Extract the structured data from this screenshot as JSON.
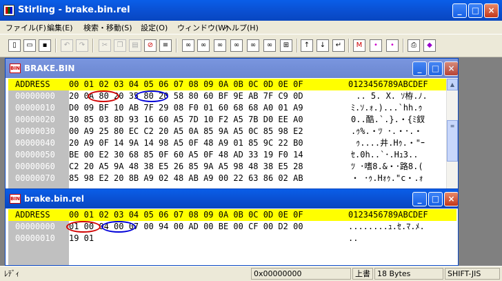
{
  "app": {
    "title": "Stirling - brake.bin.rel",
    "caption_buttons": {
      "minimize": "_",
      "maximize": "□",
      "close": "×"
    }
  },
  "menu": [
    "ファイル(F)",
    "編集(E)",
    "検索・移動(S)",
    "設定(O)",
    "ウィンドウ(W)",
    "ヘルプ(H)"
  ],
  "windows": {
    "upper": {
      "title": "BRAKE.BIN",
      "header_addr": "ADDRESS",
      "header_hex": "00 01 02 03 04 05 06 07 08 09 0A 0B 0C 0D 0E 0F",
      "header_ascii": "0123456789ABCDEF",
      "rows": [
        {
          "addr": "00000000",
          "hex": "20 0A 80 20 35 80 20 58 80 60 BF 9E AB 7F C9 0D",
          "ascii": " .. 5. X. ｿ栫.ﾉ."
        },
        {
          "addr": "00000010",
          "hex": "D0 09 BF 10 AB 7F 29 08 F0 01 60 68 68 A0 01 A9",
          "ascii": "ﾐ.ｿ.ｫ.)...`hh.ｩ"
        },
        {
          "addr": "00000020",
          "hex": "30 85 03 8D 93 16 60 A5 7D 10 F2 A5 7B D0 EE A0",
          "ascii": "0..酷.`.}.・{ﾐ釵"
        },
        {
          "addr": "00000030",
          "hex": "00 A9 25 80 EC C2 20 A5 0A 85 9A A5 0C 85 98 E2",
          "ascii": ".ｩ%.・ﾂ ･.・･.・"
        },
        {
          "addr": "00000040",
          "hex": "20 A9 0F 14 9A 14 98 A5 0F 48 A9 01 85 9C 22 B0",
          "ascii": " ｩ....井.Hｩ.・\"ｰ"
        },
        {
          "addr": "00000050",
          "hex": "BE 00 E2 30 68 85 0F 60 A5 0F 48 AD 33 19 F0 14",
          "ascii": "ｾ.0h..`･.Hｭ3.."
        },
        {
          "addr": "00000060",
          "hex": "C2 20 A5 9A 48 38 E5 26 85 9A A5 98 48 38 E5 28",
          "ascii": "ﾂ ･嗜8.&・･路8.("
        },
        {
          "addr": "00000070",
          "hex": "85 98 E2 20 8B A9 02 48 AB A9 00 22 63 86 02 AB",
          "ascii": "・ ･ｩ.Hｫｩ.\"c・.ｫ"
        }
      ]
    },
    "lower": {
      "title": "brake.bin.rel",
      "header_addr": "ADDRESS",
      "header_hex": "00 01 02 03 04 05 06 07 08 09 0A 0B 0C 0D 0E 0F",
      "header_ascii": "0123456789ABCDEF",
      "rows": [
        {
          "addr": "00000000",
          "hex": "01 00 04 00 07 00 94 00 AD 00 BE 00 CF 00 D2 00",
          "ascii": "........ｭ.ｾ.ﾏ.ﾒ."
        },
        {
          "addr": "00000010",
          "hex": "19 01",
          "ascii": ".."
        }
      ]
    }
  },
  "toolbar_icons": [
    "new-file-icon",
    "open-folder-icon",
    "save-icon",
    "undo-icon",
    "redo-icon",
    "cut-icon",
    "copy-icon",
    "paste-icon",
    "delete-icon",
    "list-icon",
    "find-icon",
    "find-next-icon",
    "find-prev-icon",
    "replace-icon",
    "compare-icon",
    "binoculars-icon",
    "page-top-icon",
    "page-down-icon",
    "page-end-icon",
    "mark-icon",
    "mark-next-icon",
    "mark-prev-icon",
    "print-icon",
    "help-book-icon"
  ],
  "status": {
    "left": "ﾚﾃﾞｨ",
    "address": "0x00000000",
    "mode": "上書",
    "size": "18 Bytes",
    "encoding": "SHIFT-JIS"
  },
  "colors": {
    "titlebar": "#0a50d8",
    "header_highlight": "#ffff00",
    "address_column": "#c0c0c0",
    "annotation_red": "#d00000",
    "annotation_blue": "#0000d8",
    "mdi_background": "#808080"
  }
}
